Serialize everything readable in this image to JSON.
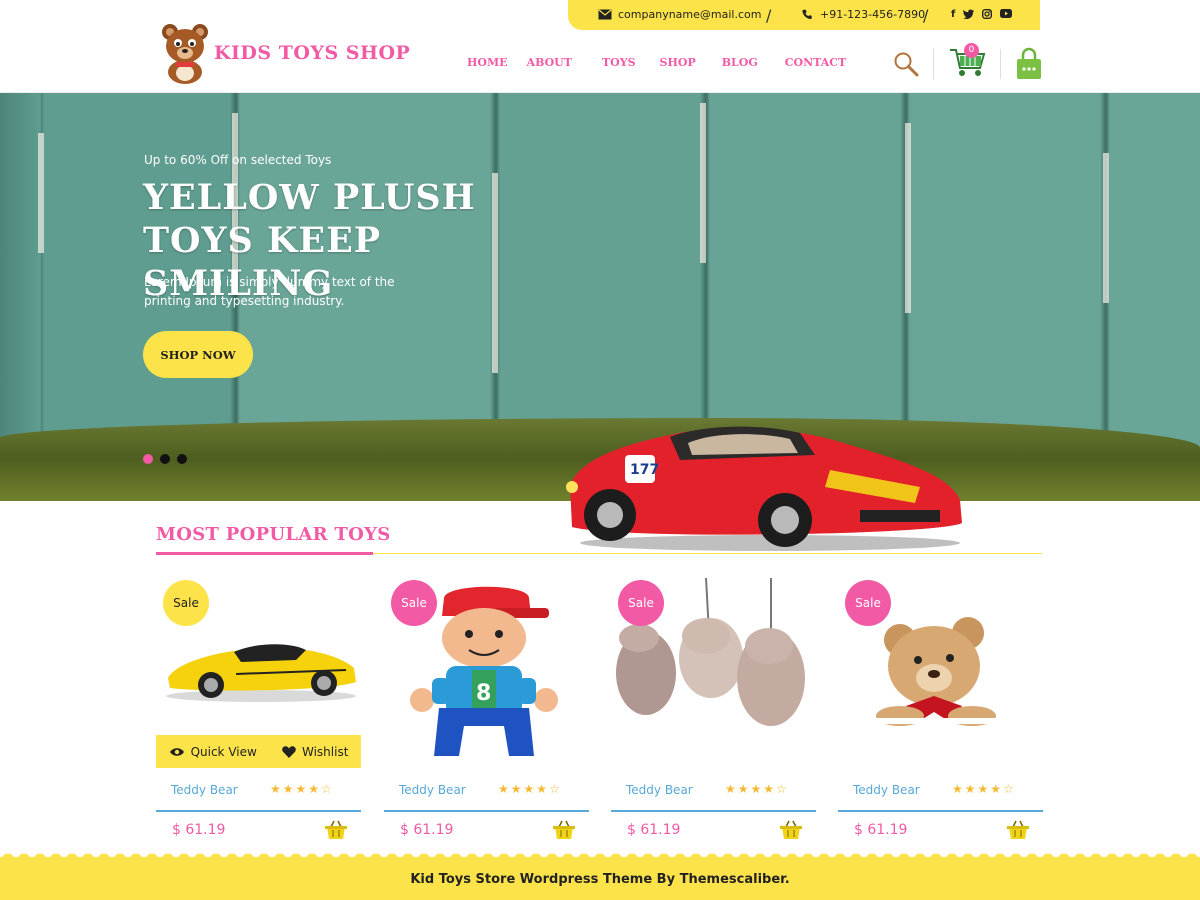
{
  "topbar": {
    "email": "companyname@mail.com",
    "phone": "+91-123-456-7890",
    "social": [
      "f",
      "t",
      "ig",
      "yt"
    ],
    "separator": "/"
  },
  "brand": {
    "name": "KIDS TOYS SHOP",
    "pink": "#f25aa6",
    "yellow": "#fde34a",
    "blue": "#57a9d8"
  },
  "nav": {
    "items": [
      "HOME",
      "ABOUT",
      "TOYS",
      "SHOP",
      "BLOG",
      "CONTACT"
    ]
  },
  "header": {
    "cart_count": "0",
    "icons": [
      "search-icon",
      "cart-icon",
      "shopping-bag-icon"
    ]
  },
  "hero": {
    "subtitle": "Up to 60% Off on selected Toys",
    "title": "YELLOW PLUSH TOYS KEEP SMILING",
    "description": "Lorem Ipsum is simply dummy text of the printing and typesetting industry.",
    "button": "SHOP NOW",
    "slides": 3,
    "active_slide": 1
  },
  "section": {
    "title": "MOST POPULAR TOYS"
  },
  "products": [
    {
      "badge": "Sale",
      "badge_color": "yellow",
      "name": "Teddy Bear",
      "price": "$ 61.19",
      "rating": 4,
      "image": "yellow-sports-car",
      "quick_view": "Quick View",
      "wishlist": "Wishlist"
    },
    {
      "badge": "Sale",
      "badge_color": "pink",
      "name": "Teddy Bear",
      "price": "$ 61.19",
      "rating": 4,
      "image": "toy-boy-figure"
    },
    {
      "badge": "Sale",
      "badge_color": "pink",
      "name": "Teddy Bear",
      "price": "$ 61.19",
      "rating": 4,
      "image": "hanging-plush-animals"
    },
    {
      "badge": "Sale",
      "badge_color": "pink",
      "name": "Teddy Bear",
      "price": "$ 61.19",
      "rating": 4,
      "image": "teddy-bear"
    }
  ],
  "footer": {
    "text": "Kid Toys Store Wordpress Theme By Themescaliber."
  }
}
